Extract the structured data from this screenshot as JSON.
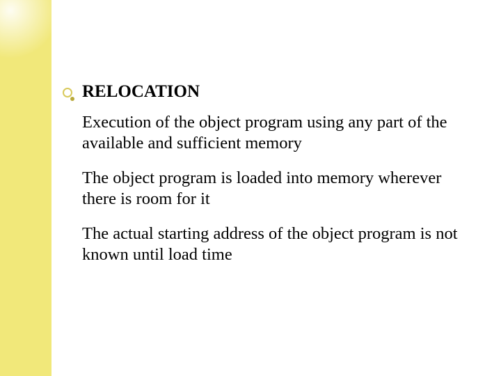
{
  "slide": {
    "heading": "RELOCATION",
    "paragraphs": [
      "Execution of the object program using any part of the available and sufficient memory",
      "The object program is loaded into memory wherever there is room for it",
      "The actual starting address of the object program is not known until load time"
    ]
  },
  "theme": {
    "sidebar_color": "#f1e87a",
    "bullet_ring_color": "#d8c95a",
    "bullet_dot_color": "#b9a93a",
    "text_color": "#000000"
  }
}
